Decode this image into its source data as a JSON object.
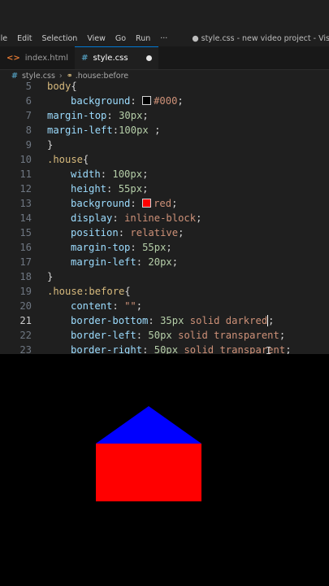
{
  "menu": {
    "items": [
      "ile",
      "Edit",
      "Selection",
      "View",
      "Go",
      "Run",
      "···"
    ],
    "window_title": "● style.css - new video project - Visual St..."
  },
  "tabs": [
    {
      "icon": "<>",
      "label": "index.html",
      "active": false
    },
    {
      "icon": "#",
      "label": "style.css",
      "active": true,
      "modified": true
    }
  ],
  "breadcrumb": {
    "file": "style.css",
    "symbol_icon": "⚭",
    "symbol": ".house:before"
  },
  "editor": {
    "current_line": 21,
    "lines": [
      {
        "n": "5",
        "parts": [
          [
            "sel",
            "body"
          ],
          [
            "pun",
            "{"
          ]
        ]
      },
      {
        "n": "6",
        "indent": 1,
        "parts": [
          [
            "prop",
            "background"
          ],
          [
            "pun",
            ": "
          ],
          [
            "swatch",
            "#000"
          ],
          [
            "val",
            "#000"
          ],
          [
            "pun",
            ";"
          ]
        ]
      },
      {
        "n": "7",
        "parts": [
          [
            "prop",
            "margin-top"
          ],
          [
            "pun",
            ": "
          ],
          [
            "num",
            "30px"
          ],
          [
            "pun",
            ";"
          ]
        ]
      },
      {
        "n": "8",
        "parts": [
          [
            "prop",
            "margin-left"
          ],
          [
            "pun",
            ":"
          ],
          [
            "num",
            "100px"
          ],
          [
            "pun",
            " ;"
          ]
        ]
      },
      {
        "n": "9",
        "parts": [
          [
            "pun",
            "}"
          ]
        ]
      },
      {
        "n": "10",
        "parts": [
          [
            "sel",
            ".house"
          ],
          [
            "pun",
            "{"
          ]
        ]
      },
      {
        "n": "11",
        "indent": 1,
        "parts": [
          [
            "prop",
            "width"
          ],
          [
            "pun",
            ": "
          ],
          [
            "num",
            "100px"
          ],
          [
            "pun",
            ";"
          ]
        ]
      },
      {
        "n": "12",
        "indent": 1,
        "parts": [
          [
            "prop",
            "height"
          ],
          [
            "pun",
            ": "
          ],
          [
            "num",
            "55px"
          ],
          [
            "pun",
            ";"
          ]
        ]
      },
      {
        "n": "13",
        "indent": 1,
        "parts": [
          [
            "prop",
            "background"
          ],
          [
            "pun",
            ": "
          ],
          [
            "swatch",
            "#ff0000"
          ],
          [
            "val",
            "red"
          ],
          [
            "pun",
            ";"
          ]
        ]
      },
      {
        "n": "14",
        "indent": 1,
        "parts": [
          [
            "prop",
            "display"
          ],
          [
            "pun",
            ": "
          ],
          [
            "val",
            "inline-block"
          ],
          [
            "pun",
            ";"
          ]
        ]
      },
      {
        "n": "15",
        "indent": 1,
        "parts": [
          [
            "prop",
            "position"
          ],
          [
            "pun",
            ": "
          ],
          [
            "val",
            "relative"
          ],
          [
            "pun",
            ";"
          ]
        ]
      },
      {
        "n": "16",
        "indent": 1,
        "parts": [
          [
            "prop",
            "margin-top"
          ],
          [
            "pun",
            ": "
          ],
          [
            "num",
            "55px"
          ],
          [
            "pun",
            ";"
          ]
        ]
      },
      {
        "n": "17",
        "indent": 1,
        "parts": [
          [
            "prop",
            "margin-left"
          ],
          [
            "pun",
            ": "
          ],
          [
            "num",
            "20px"
          ],
          [
            "pun",
            ";"
          ]
        ]
      },
      {
        "n": "18",
        "parts": [
          [
            "pun",
            "}"
          ]
        ]
      },
      {
        "n": "19",
        "parts": [
          [
            "sel",
            ".house:before"
          ],
          [
            "pun",
            "{"
          ]
        ]
      },
      {
        "n": "20",
        "indent": 1,
        "parts": [
          [
            "prop",
            "content"
          ],
          [
            "pun",
            ": "
          ],
          [
            "val",
            "\"\""
          ],
          [
            "pun",
            ";"
          ]
        ]
      },
      {
        "n": "21",
        "indent": 1,
        "parts": [
          [
            "prop",
            "border-bottom"
          ],
          [
            "pun",
            ": "
          ],
          [
            "num",
            "35px"
          ],
          [
            "val",
            " solid darkred"
          ],
          [
            "cursor",
            ""
          ],
          [
            "pun",
            ";"
          ]
        ]
      },
      {
        "n": "22",
        "indent": 1,
        "parts": [
          [
            "prop",
            "border-left"
          ],
          [
            "pun",
            ": "
          ],
          [
            "num",
            "50px"
          ],
          [
            "val",
            " solid transparent"
          ],
          [
            "pun",
            ";"
          ]
        ]
      },
      {
        "n": "23",
        "indent": 1,
        "parts": [
          [
            "prop",
            "border-right"
          ],
          [
            "pun",
            ": "
          ],
          [
            "num",
            "50px"
          ],
          [
            "val",
            " solid transparent"
          ],
          [
            "pun",
            ";"
          ]
        ]
      }
    ]
  },
  "colors": {
    "editor_bg": "#1f1f1f",
    "roof": "#0000ff",
    "house": "#ff0000",
    "preview_bg": "#000000"
  }
}
